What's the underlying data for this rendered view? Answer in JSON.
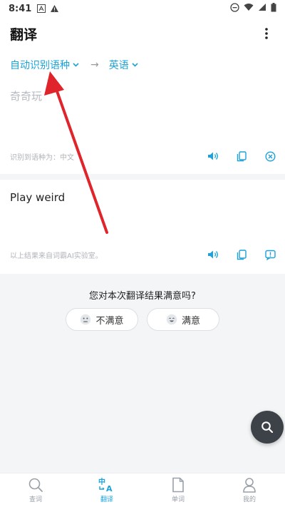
{
  "status": {
    "time": "8:41"
  },
  "header": {
    "title": "翻译"
  },
  "lang": {
    "source": "自动识别语种",
    "arrow": "→",
    "target": "英语"
  },
  "input": {
    "text": "奇奇玩",
    "detected": "识别到语种为：中文"
  },
  "result": {
    "text": "Play weird",
    "source_note": "以上结果来自词霸AI实验室。"
  },
  "feedback": {
    "question": "您对本次翻译结果满意吗?",
    "unsatisfied": "不满意",
    "satisfied": "满意"
  },
  "tabs": [
    {
      "label": "查词",
      "icon": "search-icon"
    },
    {
      "label": "翻译",
      "icon": "translate-icon"
    },
    {
      "label": "单词",
      "icon": "document-icon"
    },
    {
      "label": "我的",
      "icon": "person-icon"
    }
  ],
  "colors": {
    "accent": "#1aa3d9",
    "annotation": "#e0242b"
  }
}
